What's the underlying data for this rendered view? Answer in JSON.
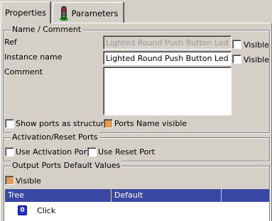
{
  "tabs": [
    {
      "label": "Properties",
      "active": true
    },
    {
      "label": "Parameters",
      "active": false,
      "icon": "traffic-light-icon"
    }
  ],
  "name_comment": {
    "title": "Name / Comment",
    "ref_label": "Ref",
    "ref_value": "Lighted Round Push Button Led",
    "ref_visible_label": "Visible",
    "instance_label": "Instance name",
    "instance_value": "Lighted Round Push Button Led",
    "instance_visible_label": "Visible",
    "comment_label": "Comment",
    "comment_value": "",
    "show_ports_label": "Show ports as structure",
    "ports_name_visible_label": "Ports Name visible"
  },
  "activation": {
    "title": "Activation/Reset Ports",
    "use_activation_label": "Use Activation Port",
    "use_reset_label": "Use Reset Port"
  },
  "output": {
    "title": "Output Ports Default Values",
    "visible_label": "Visible",
    "columns": [
      "Tree",
      "Default"
    ],
    "rows": [
      {
        "icon": "port-icon",
        "icon_text": "0",
        "name": "Click",
        "default": ""
      }
    ]
  },
  "colors": {
    "background": "#d4d0c8",
    "header": "#3a48a4",
    "checked_orange": "#e09a5c",
    "disabled_text": "#9a9a9a"
  }
}
